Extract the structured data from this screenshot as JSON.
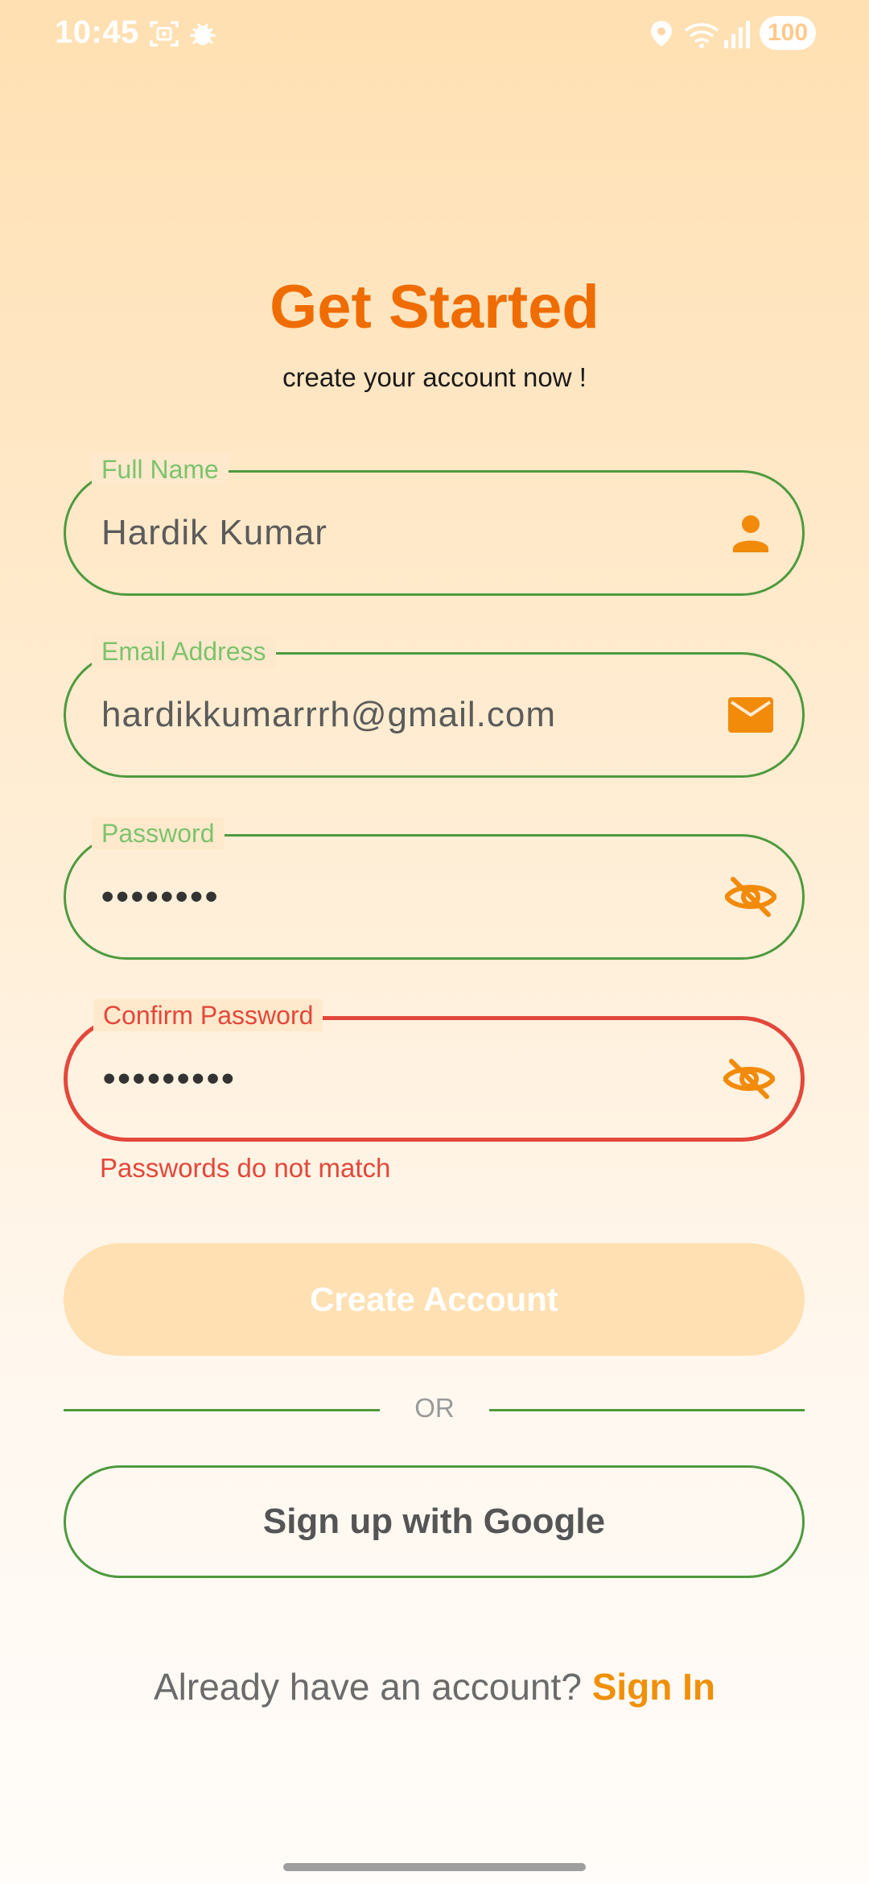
{
  "status_bar": {
    "time": "10:45",
    "battery": "100",
    "icons": [
      "screenshot-icon",
      "bug-icon",
      "location-icon",
      "wifi-icon",
      "signal-icon",
      "battery-icon"
    ]
  },
  "header": {
    "title": "Get Started",
    "subtitle": "create your account now !"
  },
  "form": {
    "full_name": {
      "label": "Full Name",
      "value": "Hardik Kumar",
      "icon": "person-icon"
    },
    "email": {
      "label": "Email Address",
      "value": "hardikkumarrrh@gmail.com",
      "icon": "mail-icon"
    },
    "password": {
      "label": "Password",
      "value": "••••••••",
      "icon": "visibility-off-icon"
    },
    "confirm_password": {
      "label": "Confirm Password",
      "value": "•••••••••",
      "icon": "visibility-off-icon",
      "error": "Passwords do not match"
    }
  },
  "actions": {
    "create_account": "Create Account",
    "divider": "OR",
    "google": "Sign up with Google",
    "signin_prompt": "Already have an account?",
    "signin_link": "Sign In"
  },
  "colors": {
    "accent": "#EF6C00",
    "link": "#F0900A",
    "outline": "#4E9A3E",
    "label": "#7CC36E",
    "error": "#E4473B",
    "disabled_button": "#FFE0B2"
  }
}
